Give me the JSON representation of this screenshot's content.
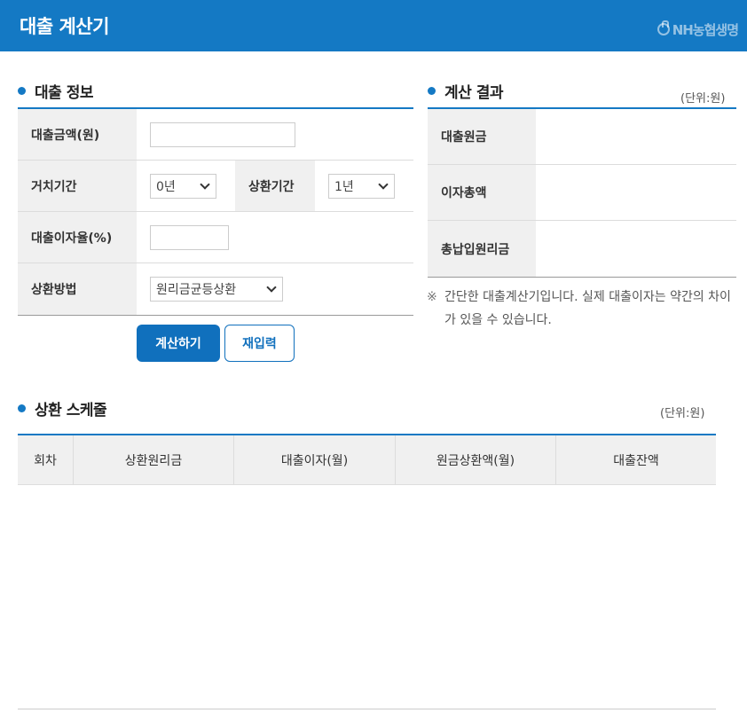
{
  "header": {
    "title": "대출 계산기",
    "logo": "NH농협생명"
  },
  "loan_info": {
    "title": "대출 정보",
    "fields": {
      "amount_label": "대출금액(원)",
      "grace_label": "거치기간",
      "grace_value": "0년",
      "repay_period_label": "상환기간",
      "repay_period_value": "1년",
      "rate_label": "대출이자율(%)",
      "method_label": "상환방법",
      "method_value": "원리금균등상환"
    },
    "buttons": {
      "calculate": "계산하기",
      "reset": "재입력"
    }
  },
  "result": {
    "title": "계산 결과",
    "unit": "(단위:원)",
    "rows": [
      "대출원금",
      "이자총액",
      "총납입원리금"
    ],
    "note_mark": "※",
    "note": "간단한 대출계산기입니다. 실제 대출이자는 약간의 차이가 있을 수 있습니다."
  },
  "schedule": {
    "title": "상환 스케줄",
    "unit": "(단위:원)",
    "columns": [
      "회차",
      "상환원리금",
      "대출이자(월)",
      "원금상환액(월)",
      "대출잔액"
    ]
  },
  "colors": {
    "brand": "#1479c4",
    "button": "#1070bd"
  }
}
